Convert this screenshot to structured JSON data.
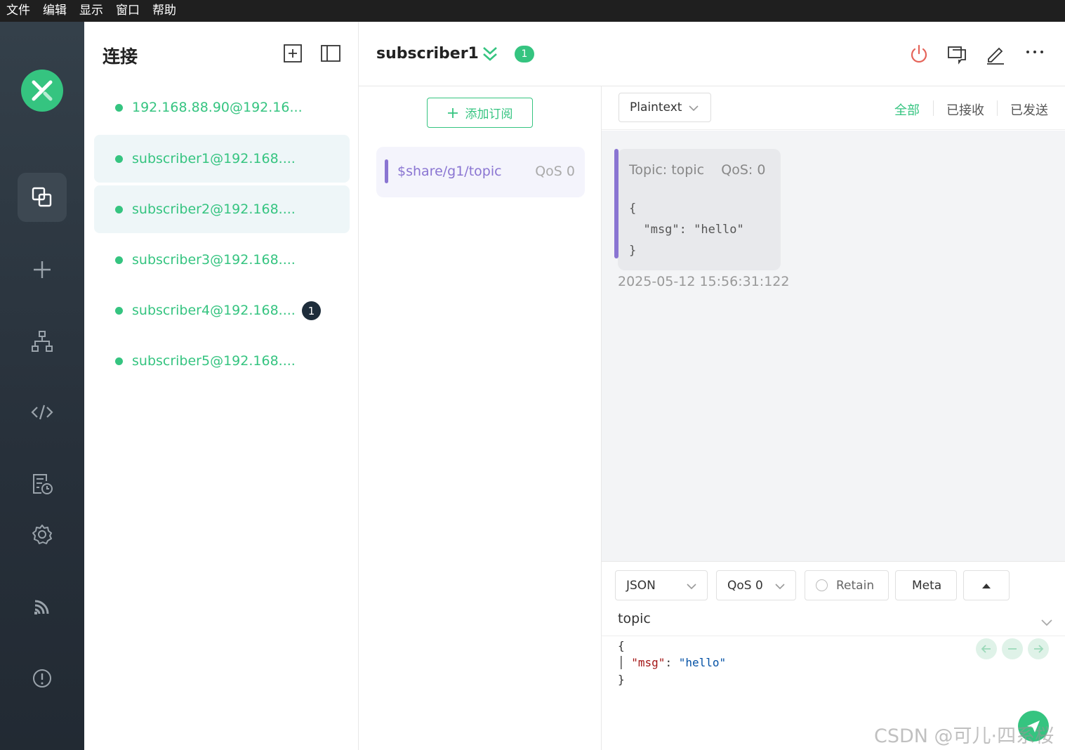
{
  "menu": [
    "文件",
    "编辑",
    "显示",
    "窗口",
    "帮助"
  ],
  "sidebar": {
    "nav": [
      "connections",
      "new-connection",
      "topic-tree",
      "script",
      "log",
      "settings",
      "subscribe-feed",
      "about"
    ]
  },
  "connections": {
    "title": "连接",
    "items": [
      {
        "label": "192.168.88.90@192.16...",
        "selected": false,
        "unread": ""
      },
      {
        "label": "subscriber1@192.168....",
        "selected": true,
        "unread": ""
      },
      {
        "label": "subscriber2@192.168....",
        "selected": true,
        "unread": ""
      },
      {
        "label": "subscriber3@192.168....",
        "selected": false,
        "unread": ""
      },
      {
        "label": "subscriber4@192.168....",
        "selected": false,
        "unread": "1"
      },
      {
        "label": "subscriber5@192.168....",
        "selected": false,
        "unread": ""
      }
    ]
  },
  "header": {
    "name": "subscriber1",
    "badge": "1"
  },
  "subscriptions": {
    "add_label": "添加订阅",
    "items": [
      {
        "topic": "$share/g1/topic",
        "qos": "QoS 0",
        "color": "#8a75d2"
      }
    ]
  },
  "messages": {
    "format": "Plaintext",
    "filters": [
      "全部",
      "已接收",
      "已发送"
    ],
    "active_filter": "全部",
    "items": [
      {
        "meta": "Topic: topic    QoS: 0",
        "payload": "{\n  \"msg\": \"hello\"\n}",
        "time": "2025-05-12 15:56:31:122"
      }
    ]
  },
  "composer": {
    "payload_type": "JSON",
    "qos": "QoS 0",
    "retain": "Retain",
    "meta": "Meta",
    "topic": "topic",
    "editor": {
      "open": "{",
      "key": "\"msg\"",
      "colon": ": ",
      "value": "\"hello\"",
      "close": "}"
    }
  },
  "colors": {
    "accent": "#35c480",
    "subscription": "#8a75d2",
    "danger": "#e5645a"
  },
  "watermark": "CSDN @可儿·四系桜"
}
